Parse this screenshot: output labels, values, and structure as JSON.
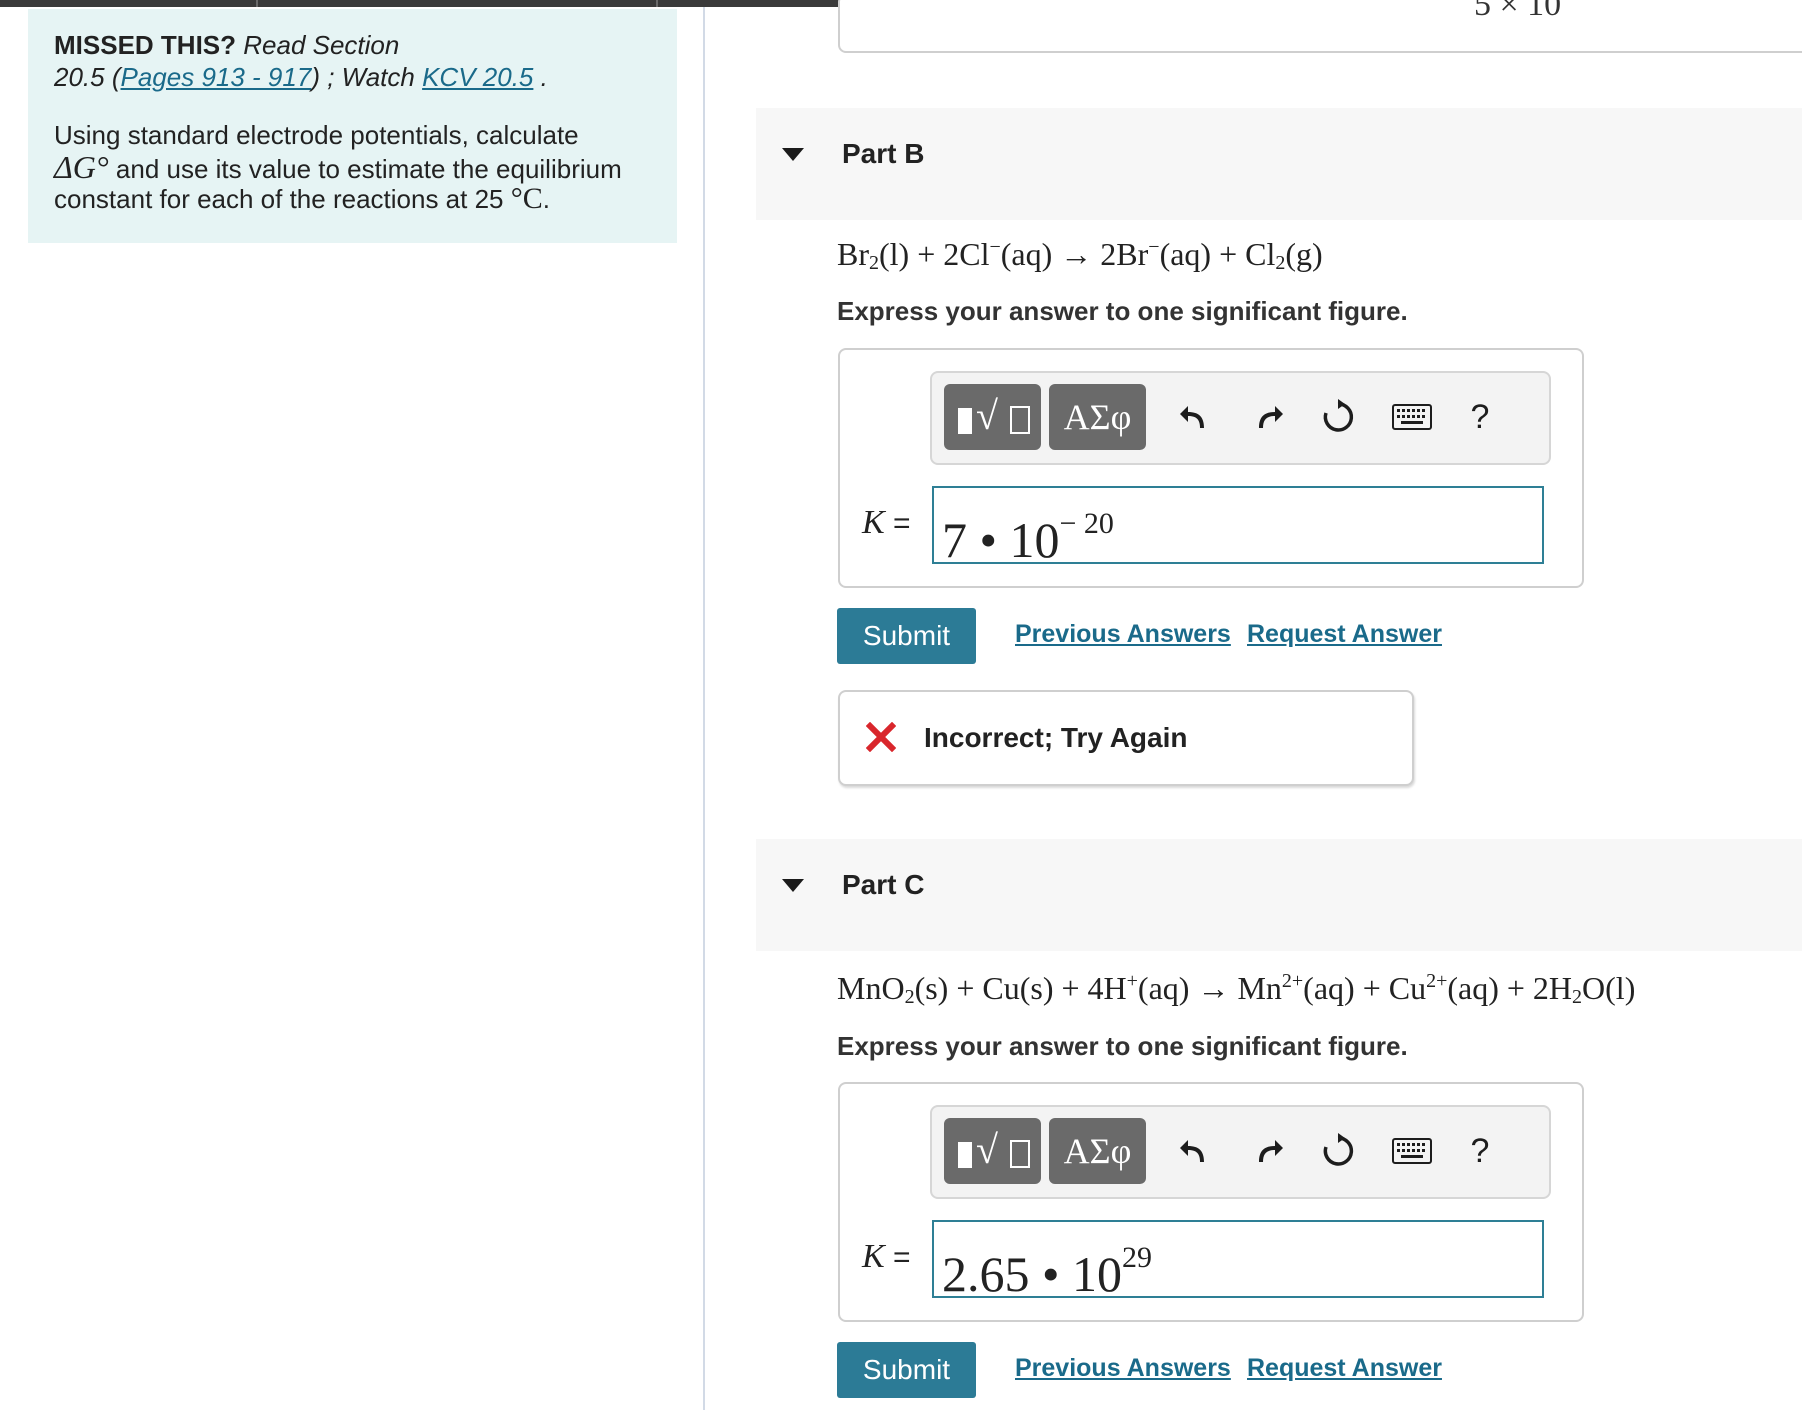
{
  "left_panel": {
    "missed_this": "MISSED THIS?",
    "read_section": "Read Section",
    "section_prefix": "20.5 (",
    "pages_link": "Pages 913 - 917",
    "watch_text": ") ; Watch ",
    "kcv_link": "KCV 20.5",
    "period": " .",
    "instr_line1": "Using standard electrode potentials, calculate",
    "delta_g": "ΔG°",
    "instr_line2_rest": " and use its value to estimate the equilibrium",
    "instr_line3": "constant for each of the reactions at 25",
    "degree_c": "°C",
    "instr_line3_end": "."
  },
  "part_a": {
    "value_fragment": "5 × 10"
  },
  "part_b": {
    "title": "Part B",
    "equation": {
      "t1": "Br",
      "s1": "2",
      "t2": "(l) + 2Cl",
      "s2": "−",
      "t3": "(aq) → 2Br",
      "s3": "−",
      "t4": "(aq) + Cl",
      "s4": "2",
      "t5": "(g)"
    },
    "instruction": "Express your answer to one significant figure.",
    "toolbar": {
      "greek": "ΑΣφ",
      "help": "?"
    },
    "k_symbol": "K",
    "equals": " =",
    "answer_base": "7 • 10",
    "answer_exp": "− 20",
    "submit": "Submit",
    "previous_answers": "Previous Answers",
    "request_answer": "Request Answer",
    "feedback": "Incorrect; Try Again"
  },
  "part_c": {
    "title": "Part C",
    "equation": {
      "t1": "MnO",
      "s1": "2",
      "t2": "(s) + Cu(s) + 4H",
      "s2": "+",
      "t3": "(aq) → Mn",
      "s3": "2+",
      "t4": "(aq) + Cu",
      "s4": "2+",
      "t5": "(aq) + 2H",
      "s5": "2",
      "t6": "O(l)"
    },
    "instruction": "Express your answer to one significant figure.",
    "toolbar": {
      "greek": "ΑΣφ",
      "help": "?"
    },
    "k_symbol": "K",
    "equals": " =",
    "answer_base": "2.65 • 10",
    "answer_exp": "29",
    "submit": "Submit",
    "previous_answers": "Previous Answers",
    "request_answer": "Request Answer"
  },
  "colors": {
    "missed_bg": "#e6f4f4",
    "link": "#1a6a8a",
    "submit_bg": "#2c7b96",
    "input_border": "#2e7f95",
    "error_red": "#d9262c"
  }
}
